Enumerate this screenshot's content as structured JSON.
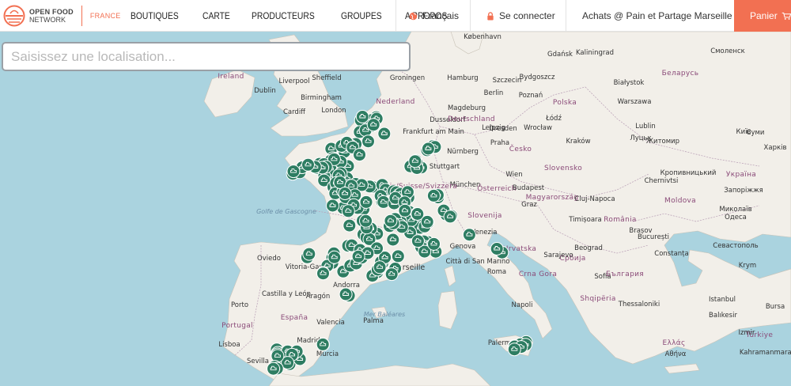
{
  "brand": {
    "line1": "OPEN FOOD",
    "line2": "NETWORK",
    "country": "FRANCE"
  },
  "nav": [
    "BOUTIQUES",
    "CARTE",
    "PRODUCTEURS",
    "GROUPES",
    "A PROPOS"
  ],
  "header_right": {
    "language": "Français",
    "login": "Se connecter",
    "shop": "Achats @ Pain et Partage Marseille",
    "cart": "Panier"
  },
  "colors": {
    "accent": "#f27052",
    "marker": "#2e7d62",
    "land": "#f2efe9",
    "water": "#aad3df"
  },
  "search": {
    "placeholder": "Saisissez une localisation..."
  },
  "map_labels": [
    {
      "text": "København",
      "cls": ""
    },
    {
      "text": "Kaliningrad",
      "cls": ""
    },
    {
      "text": "Gdańsk",
      "cls": ""
    },
    {
      "text": "Смоленск",
      "cls": ""
    },
    {
      "text": "Ireland",
      "cls": "country"
    },
    {
      "text": "Liverpool",
      "cls": ""
    },
    {
      "text": "Sheffield",
      "cls": ""
    },
    {
      "text": "Dublin",
      "cls": ""
    },
    {
      "text": "Birmingham",
      "cls": ""
    },
    {
      "text": "Cardiff",
      "cls": ""
    },
    {
      "text": "London",
      "cls": ""
    },
    {
      "text": "Hamburg",
      "cls": ""
    },
    {
      "text": "Groningen",
      "cls": ""
    },
    {
      "text": "Szczecin",
      "cls": ""
    },
    {
      "text": "Bydgoszcz",
      "cls": ""
    },
    {
      "text": "Białystok",
      "cls": ""
    },
    {
      "text": "Беларусь",
      "cls": "country"
    },
    {
      "text": "Nederland",
      "cls": "country"
    },
    {
      "text": "Berlin",
      "cls": ""
    },
    {
      "text": "Poznań",
      "cls": ""
    },
    {
      "text": "Polska",
      "cls": "country"
    },
    {
      "text": "Warszawa",
      "cls": ""
    },
    {
      "text": "Magdeburg",
      "cls": ""
    },
    {
      "text": "Łódź",
      "cls": ""
    },
    {
      "text": "Dusseldorf",
      "cls": ""
    },
    {
      "text": "Leipzig",
      "cls": ""
    },
    {
      "text": "Deutschland",
      "cls": "country"
    },
    {
      "text": "Dresden",
      "cls": ""
    },
    {
      "text": "Wrocław",
      "cls": ""
    },
    {
      "text": "Lublin",
      "cls": ""
    },
    {
      "text": "Луцьк",
      "cls": ""
    },
    {
      "text": "Київ",
      "cls": ""
    },
    {
      "text": "Frankfurt am Main",
      "cls": ""
    },
    {
      "text": "Praha",
      "cls": ""
    },
    {
      "text": "Česko",
      "cls": "country"
    },
    {
      "text": "Kraków",
      "cls": ""
    },
    {
      "text": "Житомир",
      "cls": ""
    },
    {
      "text": "Суми",
      "cls": ""
    },
    {
      "text": "Харків",
      "cls": ""
    },
    {
      "text": "Nürnberg",
      "cls": ""
    },
    {
      "text": "Stuttgart",
      "cls": ""
    },
    {
      "text": "Slovensko",
      "cls": "country"
    },
    {
      "text": "Кропивницький",
      "cls": ""
    },
    {
      "text": "Україна",
      "cls": "country"
    },
    {
      "text": "Wien",
      "cls": ""
    },
    {
      "text": "München",
      "cls": ""
    },
    {
      "text": "Österreich",
      "cls": "country"
    },
    {
      "text": "Budapest",
      "cls": ""
    },
    {
      "text": "Magyarország",
      "cls": "country"
    },
    {
      "text": "Chernivtsi",
      "cls": ""
    },
    {
      "text": "Cluj-Napoca",
      "cls": ""
    },
    {
      "text": "Moldova",
      "cls": "country"
    },
    {
      "text": "Запоріжжя",
      "cls": ""
    },
    {
      "text": "Миколаїв",
      "cls": ""
    },
    {
      "text": "Одеса",
      "cls": ""
    },
    {
      "text": "Schweiz/Suisse/Svizzera",
      "cls": "country"
    },
    {
      "text": "Graz",
      "cls": ""
    },
    {
      "text": "Slovenija",
      "cls": "country"
    },
    {
      "text": "Timișoara",
      "cls": ""
    },
    {
      "text": "România",
      "cls": "country"
    },
    {
      "text": "Brașov",
      "cls": ""
    },
    {
      "text": "Golfe de Gascogne",
      "cls": "sea"
    },
    {
      "text": "Venezia",
      "cls": ""
    },
    {
      "text": "Hrvatska",
      "cls": "country"
    },
    {
      "text": "Beograd",
      "cls": ""
    },
    {
      "text": "Србија",
      "cls": "country"
    },
    {
      "text": "București",
      "cls": ""
    },
    {
      "text": "Constanța",
      "cls": ""
    },
    {
      "text": "Севастополь",
      "cls": ""
    },
    {
      "text": "Krym",
      "cls": ""
    },
    {
      "text": "Oviedo",
      "cls": ""
    },
    {
      "text": "Porto",
      "cls": ""
    },
    {
      "text": "Genova",
      "cls": ""
    },
    {
      "text": "Città di San Marino",
      "cls": ""
    },
    {
      "text": "Sarajevo",
      "cls": ""
    },
    {
      "text": "Crna Gora",
      "cls": "country"
    },
    {
      "text": "Sofia",
      "cls": ""
    },
    {
      "text": "България",
      "cls": "country"
    },
    {
      "text": "Marseille",
      "cls": "big"
    },
    {
      "text": "Andorra",
      "cls": ""
    },
    {
      "text": "Vitoria-Gasteiz",
      "cls": ""
    },
    {
      "text": "Castilla y León",
      "cls": ""
    },
    {
      "text": "Aragón",
      "cls": ""
    },
    {
      "text": "España",
      "cls": "country"
    },
    {
      "text": "Valencia",
      "cls": ""
    },
    {
      "text": "Palma",
      "cls": ""
    },
    {
      "text": "Portugal",
      "cls": "country"
    },
    {
      "text": "Lisboa",
      "cls": ""
    },
    {
      "text": "Madrid",
      "cls": ""
    },
    {
      "text": "Roma",
      "cls": ""
    },
    {
      "text": "Napoli",
      "cls": ""
    },
    {
      "text": "Shqipëria",
      "cls": "country"
    },
    {
      "text": "Thessaloniki",
      "cls": ""
    },
    {
      "text": "Istanbul",
      "cls": ""
    },
    {
      "text": "Bursa",
      "cls": ""
    },
    {
      "text": "Türkiye",
      "cls": "country"
    },
    {
      "text": "Murcia",
      "cls": ""
    },
    {
      "text": "Sevilla",
      "cls": ""
    },
    {
      "text": "Palermo",
      "cls": ""
    },
    {
      "text": "Ελλάς",
      "cls": "country"
    },
    {
      "text": "Αθήνα",
      "cls": ""
    },
    {
      "text": "Izmir",
      "cls": ""
    },
    {
      "text": "Kahramanmaraş",
      "cls": ""
    },
    {
      "text": "Balıkesir",
      "cls": ""
    },
    {
      "text": "Mer Baléares",
      "cls": "sea"
    }
  ]
}
